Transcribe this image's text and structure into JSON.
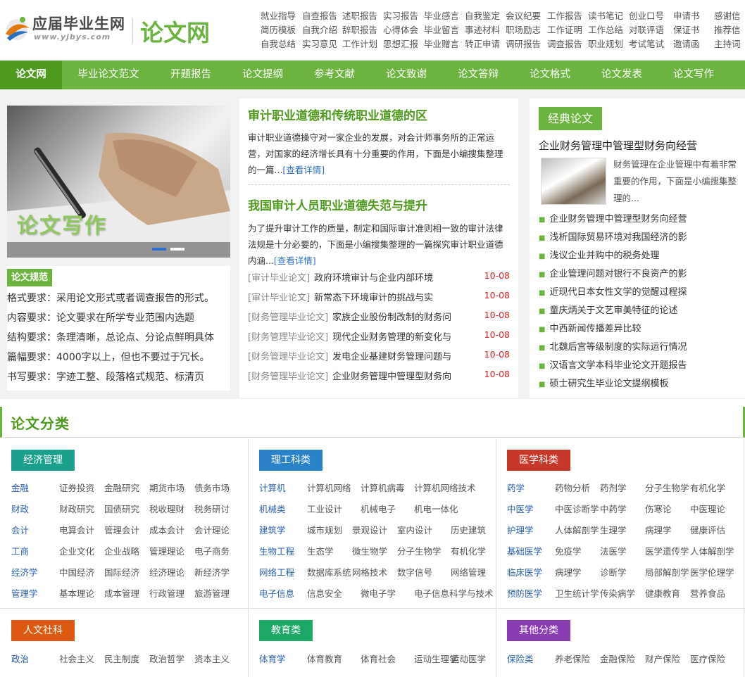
{
  "header": {
    "logo_cn": "应届毕业生网",
    "logo_url": "www.yjbys.com",
    "site_title": "论文网",
    "links": [
      [
        "就业指导",
        "自查报告",
        "述职报告",
        "实习报告",
        "毕业感言",
        "自我鉴定",
        "会议纪要",
        "工作报告",
        "读书笔记",
        "创业口号",
        "申请书",
        "感谢信"
      ],
      [
        "简历模板",
        "自我介绍",
        "辞职报告",
        "心得体会",
        "毕业留言",
        "事迹材料",
        "职场励志",
        "工作证明",
        "工作总结",
        "对联评语",
        "保证书",
        "推荐信"
      ],
      [
        "自我总结",
        "实习意见",
        "工作计划",
        "思想汇报",
        "毕业赠言",
        "转正申请",
        "调研报告",
        "调查报告",
        "职业规划",
        "考试笔试",
        "邀请函",
        "主持词"
      ]
    ]
  },
  "nav": {
    "items": [
      "论文网",
      "毕业论文范文",
      "开题报告",
      "论文提纲",
      "参考文献",
      "论文致谢",
      "论文答辩",
      "论文格式",
      "论文发表",
      "论文写作"
    ],
    "active_index": 0
  },
  "hero": {
    "title": "论文写作",
    "slide_count": 2,
    "active_slide": 0
  },
  "specs": {
    "tag": "论文规范",
    "rows": [
      {
        "key": "格式要求：",
        "value": "采用论文形式或者调查报告的形式。"
      },
      {
        "key": "内容要求：",
        "value": "论文要求在所学专业范围内选题"
      },
      {
        "key": "结构要求：",
        "value": "条理清晰，总论点、分论点鲜明具体"
      },
      {
        "key": "篇幅要求：",
        "value": "4000字以上，但也不要过于冗长。"
      },
      {
        "key": "书写要求：",
        "value": "字迹工整、段落格式规范、标清页"
      }
    ]
  },
  "featured": [
    {
      "title": "审计职业道德和传统职业道德的区",
      "body": "审计职业道德操守对一家企业的发展，对会计师事务所的正常运营，对国家的经济增长具有十分重要的作用，下面是小编搜集整理的一篇...",
      "more": "[查看详情]"
    },
    {
      "title": "我国审计人员职业道德失范与提升",
      "body": "为了提升审计工作的质量，制定和国际审计准则相一致的审计法律法规是十分必要的，下面是小编搜集整理的一篇探究审计职业道德内涵...",
      "more": "[查看详情]"
    }
  ],
  "latest": [
    {
      "cat": "[审计毕业论文]",
      "title": "政府环境审计与企业内部环境",
      "date": "10-08"
    },
    {
      "cat": "[审计毕业论文]",
      "title": "新常态下环境审计的挑战与实",
      "date": "10-08"
    },
    {
      "cat": "[财务管理毕业论文]",
      "title": "家族企业股份制改制的财务问",
      "date": "10-08"
    },
    {
      "cat": "[财务管理毕业论文]",
      "title": "现代企业财务管理的新变化与",
      "date": "10-08"
    },
    {
      "cat": "[财务管理毕业论文]",
      "title": "发电企业基建财务管理问题与",
      "date": "10-08"
    },
    {
      "cat": "[财务管理毕业论文]",
      "title": "企业财务管理中管理型财务向",
      "date": "10-08"
    }
  ],
  "classic": {
    "tag": "经典论文",
    "title": "企业财务管理中管理型财务向经营",
    "summary": "财务管理在企业管理中有着非常重要的作用，下面是小编搜集整理的...",
    "items": [
      "企业财务管理中管理型财务向经营",
      "浅析国际贸易环境对我国经济的影",
      "浅议企业并购中的税务处理",
      "企业管理问题对银行不良资产的影",
      "近现代日本女性文学的觉醒过程探",
      "童庆炳关于文艺审美特征的论述",
      "中西新闻传播差异比较",
      "北魏后宫等级制度的实际运行情况",
      "汉语言文学本科毕业论文开题报告",
      "硕士研究生毕业论文提纲模板"
    ]
  },
  "categories": {
    "title": "论文分类",
    "panels": [
      {
        "tag": "经济管理",
        "color": "#1aa08c",
        "rows": [
          {
            "head": "金融",
            "subs": [
              "证券投资",
              "金融研究",
              "期货市场",
              "债务市场"
            ]
          },
          {
            "head": "财政",
            "subs": [
              "财政研究",
              "国债研究",
              "税收理财",
              "税务研讨"
            ]
          },
          {
            "head": "会计",
            "subs": [
              "电算会计",
              "管理会计",
              "成本会计",
              "会计理论"
            ]
          },
          {
            "head": "工商",
            "subs": [
              "企业文化",
              "企业战略",
              "管理理论",
              "电子商务"
            ]
          },
          {
            "head": "经济学",
            "subs": [
              "中国经济",
              "国际经济",
              "经济理论",
              "新经济学"
            ]
          },
          {
            "head": "管理学",
            "subs": [
              "基本理论",
              "成本管理",
              "行政管理",
              "旅游管理"
            ]
          }
        ]
      },
      {
        "tag": "理工科类",
        "color": "#2a82c8",
        "rows": [
          {
            "head": "计算机",
            "subs": [
              "计算机网络",
              "计算机病毒",
              "计算机网络技术"
            ]
          },
          {
            "head": "机械类",
            "subs": [
              "工业设计",
              "机械电子",
              "机电一体化"
            ]
          },
          {
            "head": "建筑学",
            "subs": [
              "城市规划",
              "景观设计",
              "室内设计",
              "历史建筑"
            ]
          },
          {
            "head": "生物工程",
            "subs": [
              "生态学",
              "微生物学",
              "分子生物学",
              "有机化学"
            ]
          },
          {
            "head": "网络工程",
            "subs": [
              "数据库系统",
              "网格技术",
              "数字信号",
              "网络管理"
            ]
          },
          {
            "head": "电子信息",
            "subs": [
              "信息安全",
              "微电子学",
              "电子信息科学与技术"
            ]
          }
        ]
      },
      {
        "tag": "医学科类",
        "color": "#c8382a",
        "rows": [
          {
            "head": "药学",
            "subs": [
              "药物分析",
              "药剂学",
              "分子生物学",
              "有机化学"
            ]
          },
          {
            "head": "中医学",
            "subs": [
              "中医诊断学",
              "中药学",
              "伤寒论",
              "中医理论"
            ]
          },
          {
            "head": "护理学",
            "subs": [
              "人体解剖学",
              "生理学",
              "病理学",
              "健康评估"
            ]
          },
          {
            "head": "基础医学",
            "subs": [
              "免疫学",
              "法医学",
              "医学遗传学",
              "人体解剖学"
            ]
          },
          {
            "head": "临床医学",
            "subs": [
              "病理学",
              "诊断学",
              "局部解剖学",
              "医学伦理学"
            ]
          },
          {
            "head": "预防医学",
            "subs": [
              "卫生统计学",
              "传染病学",
              "健康教育",
              "营养食品"
            ]
          }
        ]
      },
      {
        "tag": "人文社科",
        "color": "#dc5a10",
        "rows": [
          {
            "head": "政治",
            "subs": [
              "社会主义",
              "民主制度",
              "政治哲学",
              "资本主义"
            ]
          }
        ]
      },
      {
        "tag": "教育类",
        "color": "#1ea868",
        "rows": [
          {
            "head": "体育学",
            "subs": [
              "体育教育",
              "体育社会",
              "运动生理学",
              "运动医学"
            ]
          }
        ]
      },
      {
        "tag": "其他分类",
        "color": "#8a3cb4",
        "rows": [
          {
            "head": "保险类",
            "subs": [
              "养老保险",
              "金融保险",
              "财产保险",
              "医疗保险"
            ]
          }
        ]
      }
    ]
  }
}
